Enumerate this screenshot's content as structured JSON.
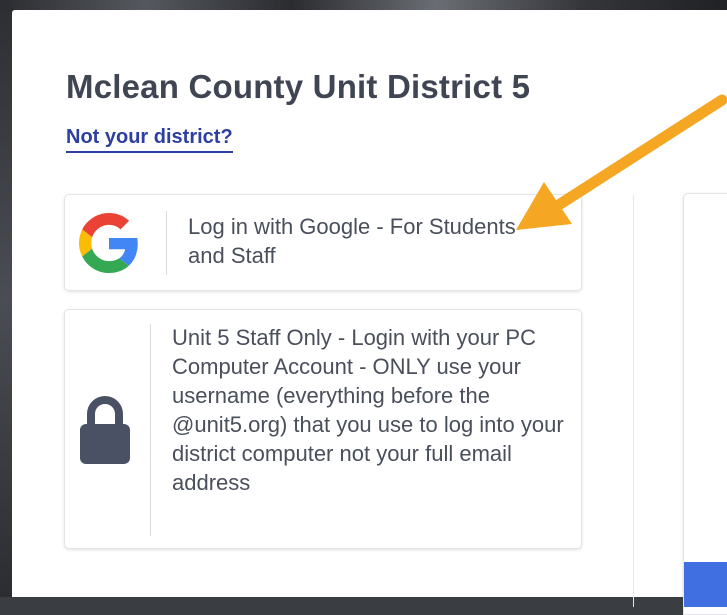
{
  "district": {
    "title": "Mclean County Unit District 5",
    "change_link": "Not your district?"
  },
  "login_options": {
    "google": {
      "label": "Log in with Google - For Students and Staff",
      "icon": "google-g-icon"
    },
    "staff": {
      "label": "Unit 5 Staff Only - Login with your PC Computer Account - ONLY use your username (everything before the @unit5.org) that you use to log into your district computer not your full email address",
      "icon": "lock-icon"
    }
  },
  "colors": {
    "title": "#3f4552",
    "link": "#2d3fa0",
    "arrow": "#f5a623",
    "button": "#3f6fe0",
    "lock": "#4b5165"
  }
}
